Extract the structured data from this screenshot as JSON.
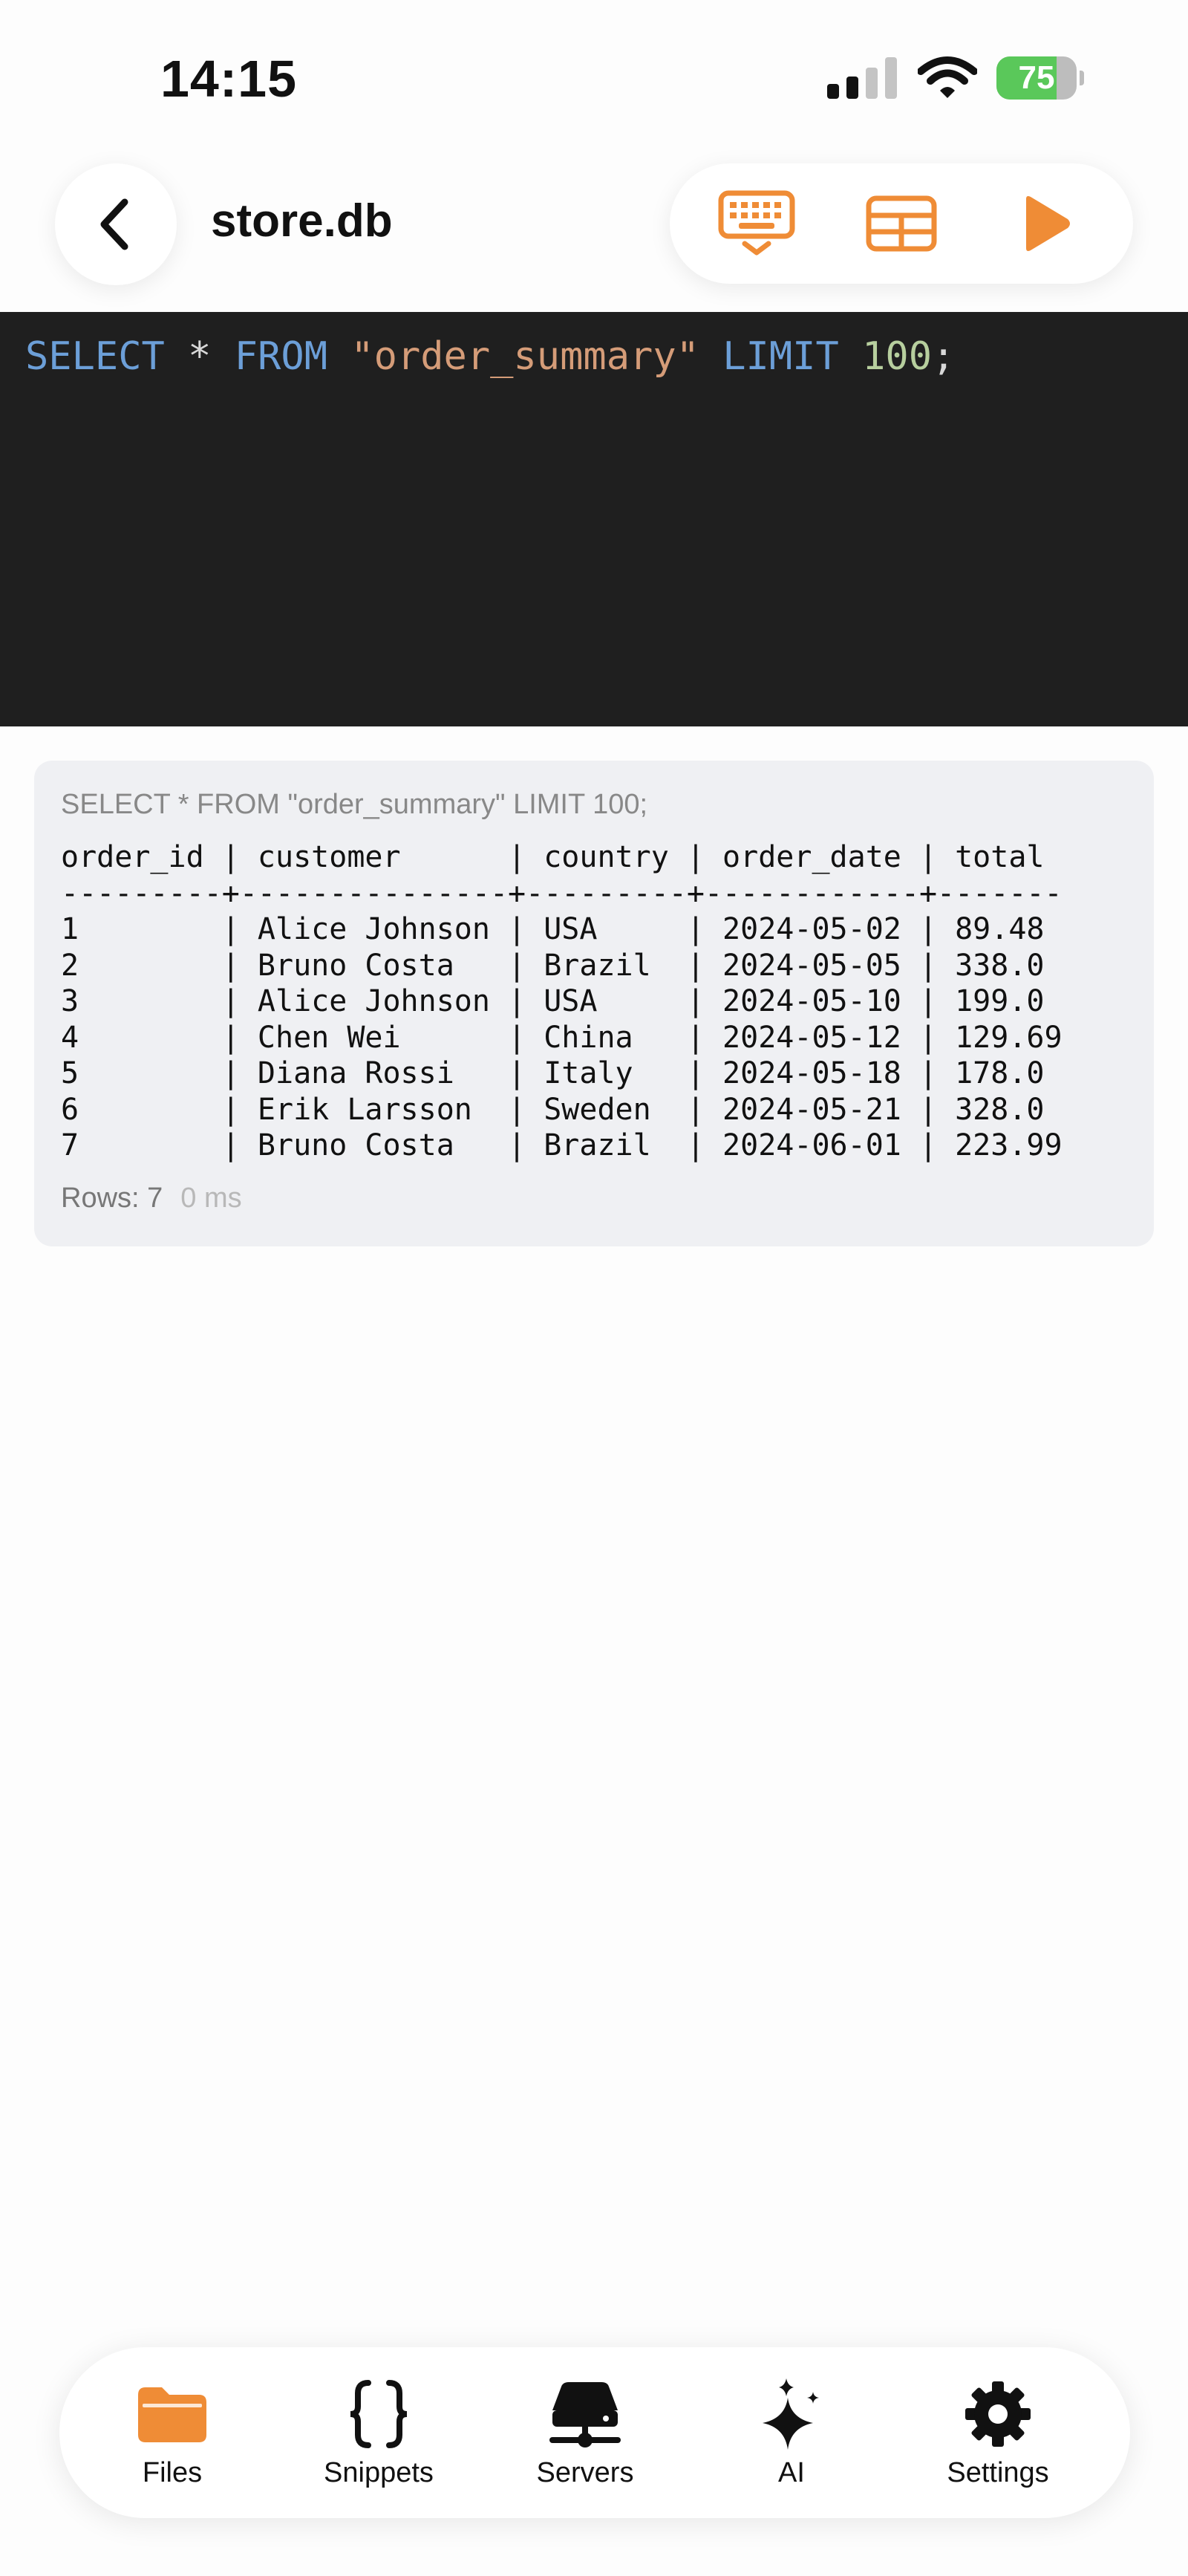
{
  "status_bar": {
    "time": "14:15",
    "battery": "75"
  },
  "header": {
    "title": "store.db"
  },
  "editor": {
    "tokens": {
      "select": "SELECT",
      "star": "*",
      "from": "FROM",
      "table": "\"order_summary\"",
      "limit": "LIMIT",
      "limit_value": "100",
      "semicolon": ";"
    }
  },
  "results": {
    "query": "SELECT * FROM \"order_summary\" LIMIT 100;",
    "columns": [
      "order_id",
      "customer",
      "country",
      "order_date",
      "total"
    ],
    "rows": [
      [
        "1",
        "Alice Johnson",
        "USA",
        "2024-05-02",
        "89.48"
      ],
      [
        "2",
        "Bruno Costa",
        "Brazil",
        "2024-05-05",
        "338.0"
      ],
      [
        "3",
        "Alice Johnson",
        "USA",
        "2024-05-10",
        "199.0"
      ],
      [
        "4",
        "Chen Wei",
        "China",
        "2024-05-12",
        "129.69"
      ],
      [
        "5",
        "Diana Rossi",
        "Italy",
        "2024-05-18",
        "178.0"
      ],
      [
        "6",
        "Erik Larsson",
        "Sweden",
        "2024-05-21",
        "328.0"
      ],
      [
        "7",
        "Bruno Costa",
        "Brazil",
        "2024-06-01",
        "223.99"
      ]
    ],
    "rows_label": "Rows: 7",
    "time_label": "0 ms"
  },
  "tabs": [
    {
      "label": "Files",
      "icon": "folder-icon",
      "active": true
    },
    {
      "label": "Snippets",
      "icon": "braces-icon",
      "active": false
    },
    {
      "label": "Servers",
      "icon": "server-icon",
      "active": false
    },
    {
      "label": "AI",
      "icon": "sparkles-icon",
      "active": false
    },
    {
      "label": "Settings",
      "icon": "gear-icon",
      "active": false
    }
  ],
  "colors": {
    "accent": "#ef8c36",
    "editor_bg": "#1f1f1f",
    "keyword": "#6c9fd8",
    "string": "#d59c78",
    "number": "#b7cf9e",
    "battery": "#5ac85a"
  }
}
